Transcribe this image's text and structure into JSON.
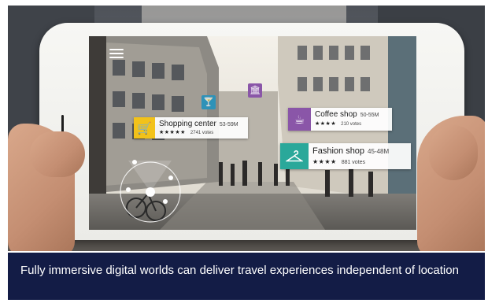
{
  "scene": {
    "menu_icon": "hamburger-menu-icon",
    "floating_icons": [
      {
        "name": "cocktail-bar-icon",
        "color": "#2e92b8"
      },
      {
        "name": "theater-icon",
        "color": "#8a56a8"
      }
    ]
  },
  "poi_cards": [
    {
      "name": "Shopping center",
      "distance": "53-59M",
      "stars": "★★★★★",
      "votes": "2741 votes",
      "icon": "shopping-cart-icon",
      "color": "#f2c21a"
    },
    {
      "name": "Coffee shop",
      "distance": "50-55M",
      "stars": "★★★★",
      "votes": "210 votes",
      "icon": "coffee-cup-icon",
      "color": "#8a56a8"
    },
    {
      "name": "Fashion shop",
      "distance": "45-48M",
      "stars": "★★★★",
      "votes": "881 votes",
      "icon": "clothes-hanger-icon",
      "color": "#2aa89a"
    }
  ],
  "caption": {
    "text": "Fully immersive digital worlds can deliver travel experiences independent of location",
    "background": "#131c46"
  }
}
